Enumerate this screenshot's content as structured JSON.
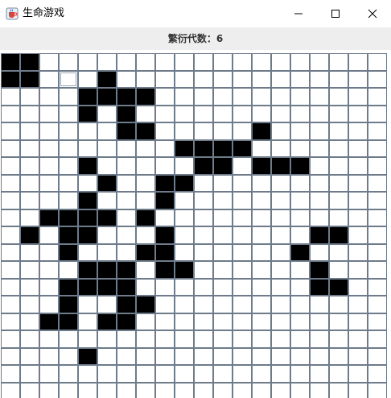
{
  "window": {
    "title": "生命游戏",
    "icons": {
      "app": "java-cup-icon",
      "minimize": "minimize-icon",
      "maximize": "maximize-icon",
      "close": "close-icon"
    }
  },
  "generation": {
    "label": "繁衍代数：6"
  },
  "grid": {
    "columns": 20,
    "visible_rows": 20,
    "alive_color": "#000000",
    "dead_color": "#ffffff",
    "line_color": "#6e7b8b",
    "focused_cell": [
      1,
      3
    ],
    "alive_cells": [
      [
        0,
        0
      ],
      [
        0,
        1
      ],
      [
        1,
        0
      ],
      [
        1,
        1
      ],
      [
        1,
        5
      ],
      [
        2,
        4
      ],
      [
        2,
        5
      ],
      [
        2,
        6
      ],
      [
        2,
        7
      ],
      [
        3,
        4
      ],
      [
        3,
        6
      ],
      [
        4,
        6
      ],
      [
        4,
        7
      ],
      [
        4,
        13
      ],
      [
        5,
        9
      ],
      [
        5,
        10
      ],
      [
        5,
        11
      ],
      [
        5,
        12
      ],
      [
        6,
        4
      ],
      [
        6,
        10
      ],
      [
        6,
        11
      ],
      [
        6,
        13
      ],
      [
        6,
        14
      ],
      [
        6,
        15
      ],
      [
        7,
        5
      ],
      [
        7,
        8
      ],
      [
        7,
        9
      ],
      [
        8,
        4
      ],
      [
        8,
        8
      ],
      [
        9,
        2
      ],
      [
        9,
        3
      ],
      [
        9,
        4
      ],
      [
        9,
        5
      ],
      [
        9,
        7
      ],
      [
        10,
        1
      ],
      [
        10,
        3
      ],
      [
        10,
        4
      ],
      [
        10,
        8
      ],
      [
        10,
        16
      ],
      [
        10,
        17
      ],
      [
        11,
        3
      ],
      [
        11,
        7
      ],
      [
        11,
        8
      ],
      [
        11,
        15
      ],
      [
        12,
        4
      ],
      [
        12,
        5
      ],
      [
        12,
        6
      ],
      [
        12,
        8
      ],
      [
        12,
        9
      ],
      [
        12,
        16
      ],
      [
        13,
        3
      ],
      [
        13,
        4
      ],
      [
        13,
        5
      ],
      [
        13,
        6
      ],
      [
        13,
        16
      ],
      [
        13,
        17
      ],
      [
        14,
        3
      ],
      [
        14,
        6
      ],
      [
        14,
        7
      ],
      [
        15,
        2
      ],
      [
        15,
        3
      ],
      [
        15,
        5
      ],
      [
        15,
        6
      ],
      [
        17,
        4
      ]
    ]
  }
}
